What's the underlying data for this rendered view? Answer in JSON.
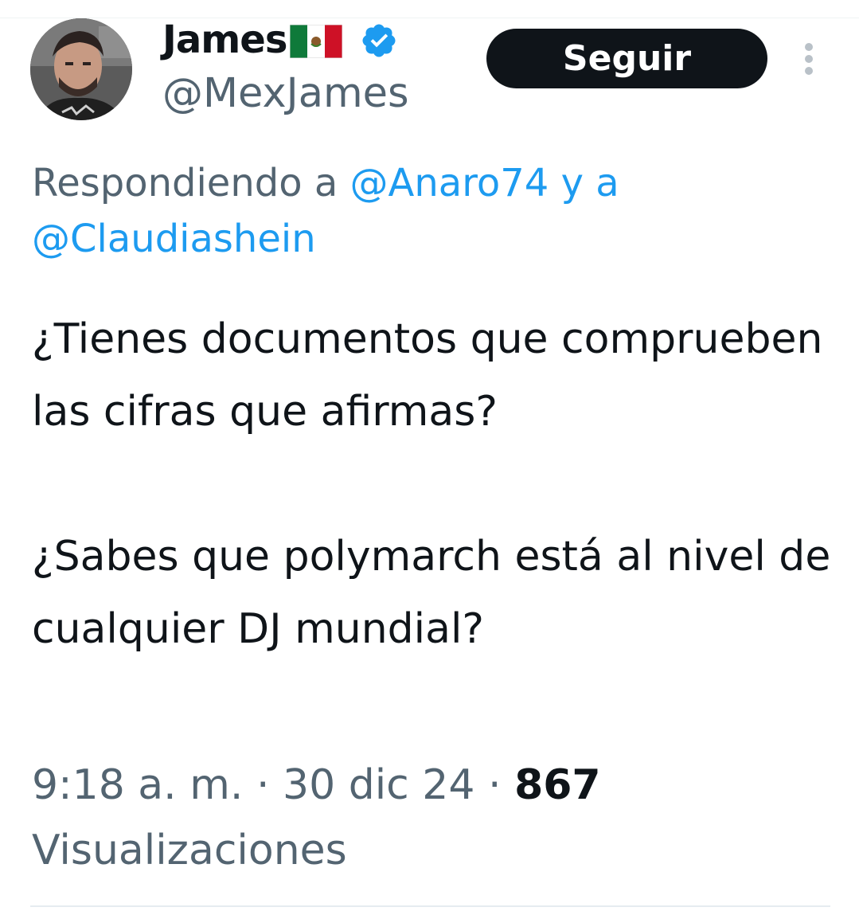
{
  "author": {
    "display_name": "James",
    "handle": "@MexJames",
    "flag_icon": "mexico-flag-icon",
    "verified_icon": "verified-badge-icon",
    "verified_color": "#1d9bf0"
  },
  "follow_button": {
    "label": "Seguir"
  },
  "more_menu": {
    "icon": "more-vertical-icon"
  },
  "reply_context": {
    "prefix": "Respondiendo a ",
    "mention_1": "@Anaro74",
    "connector": " y a",
    "mention_2": "@Claudiashein"
  },
  "tweet": {
    "paragraph_1": "¿Tienes documentos que comprueben las cifras que afirmas?",
    "paragraph_2": "¿Sabes que polymarch está al nivel de cualquier DJ mundial?"
  },
  "meta": {
    "time": "9:18 a. m.",
    "separator": " · ",
    "date": "30 dic 24",
    "views_count": "867",
    "views_label": "Visualizaciones"
  },
  "colors": {
    "text": "#0f1419",
    "secondary": "#536471",
    "link": "#1d9bf0",
    "button_bg": "#0f1419",
    "button_text": "#ffffff"
  }
}
